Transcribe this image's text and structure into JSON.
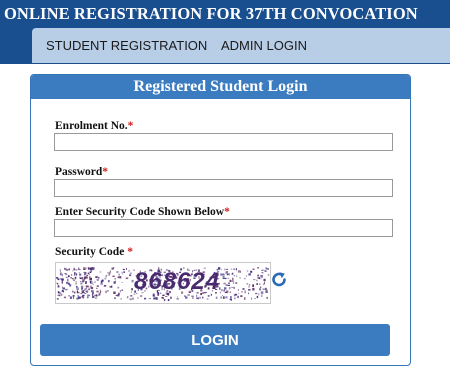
{
  "header": {
    "title": "ONLINE REGISTRATION FOR 37TH CONVOCATION",
    "bar_color": "#1a4f8f"
  },
  "nav": {
    "items": [
      {
        "label": "STUDENT REGISTRATION"
      },
      {
        "label": "ADMIN LOGIN"
      }
    ]
  },
  "login_panel": {
    "title": "Registered Student Login",
    "fields": [
      {
        "label": "Enrolment No.",
        "required_mark": "*",
        "value": ""
      },
      {
        "label": "Password",
        "required_mark": "*",
        "value": ""
      },
      {
        "label": "Enter Security Code Shown Below",
        "required_mark": "*",
        "value": ""
      }
    ],
    "security_code": {
      "label": "Security Code ",
      "required_mark": "*",
      "captcha_text": "868624",
      "refresh_icon": "refresh-icon"
    },
    "login_button": "LOGIN",
    "accent_color": "#3b7cc1",
    "required_color": "#d02020"
  }
}
